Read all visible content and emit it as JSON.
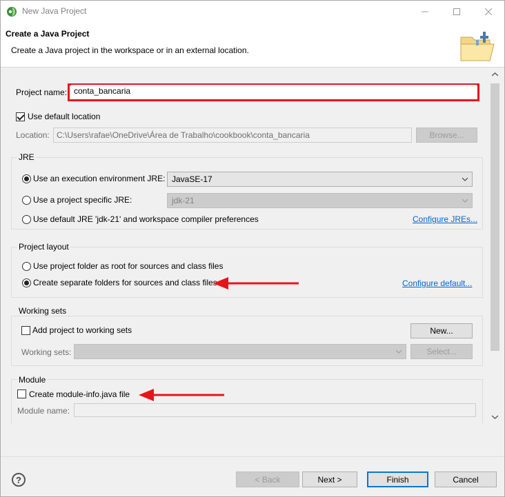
{
  "window": {
    "title": "New Java Project",
    "controls": {
      "minimize_icon": "minimize-icon",
      "maximize_icon": "maximize-icon",
      "close_icon": "close-icon"
    }
  },
  "banner": {
    "title": "Create a Java Project",
    "description": "Create a Java project in the workspace or in an external location."
  },
  "project": {
    "name_label": "Project name:",
    "name_value": "conta_bancaria",
    "use_default_location_label": "Use default location",
    "use_default_location_checked": true,
    "location_label": "Location:",
    "location_value": "C:\\Users\\rafae\\OneDrive\\Área de Trabalho\\cookbook\\conta_bancaria",
    "browse_label": "Browse..."
  },
  "jre": {
    "group_title": "JRE",
    "option_execution_env": "Use an execution environment JRE:",
    "execution_env_value": "JavaSE-17",
    "option_project_specific": "Use a project specific JRE:",
    "project_specific_value": "jdk-21",
    "option_default": "Use default JRE 'jdk-21' and workspace compiler preferences",
    "configure_link": "Configure JREs...",
    "selected": "execution_env"
  },
  "layout": {
    "group_title": "Project layout",
    "option_root": "Use project folder as root for sources and class files",
    "option_separate": "Create separate folders for sources and class files",
    "configure_link": "Configure default...",
    "selected": "separate"
  },
  "working_sets": {
    "group_title": "Working sets",
    "add_label": "Add project to working sets",
    "add_checked": false,
    "new_label": "New...",
    "sets_label": "Working sets:",
    "select_label": "Select..."
  },
  "module": {
    "group_title": "Module",
    "create_label": "Create module-info.java file",
    "create_checked": false,
    "name_label": "Module name:"
  },
  "footer": {
    "back_label": "< Back",
    "next_label": "Next >",
    "finish_label": "Finish",
    "cancel_label": "Cancel"
  },
  "colors": {
    "highlight_red": "#e8141c",
    "link_blue": "#0066cc",
    "default_button_border": "#0078d7"
  }
}
